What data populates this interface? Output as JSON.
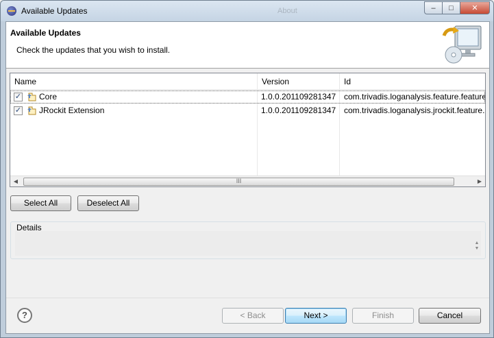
{
  "window": {
    "title": "Available Updates",
    "background_hint": "About",
    "minimize_label": "–",
    "maximize_label": "□",
    "close_label": "✕"
  },
  "banner": {
    "title": "Available Updates",
    "message": "Check the updates that you wish to install.",
    "icon": "update-monitor-icon"
  },
  "table": {
    "columns": [
      {
        "label": "Name"
      },
      {
        "label": "Version"
      },
      {
        "label": "Id"
      }
    ],
    "rows": [
      {
        "checked": true,
        "selected": true,
        "name": "Core",
        "version": "1.0.0.201109281347",
        "id": "com.trivadis.loganalysis.feature.feature"
      },
      {
        "checked": true,
        "selected": false,
        "name": "JRockit Extension",
        "version": "1.0.0.201109281347",
        "id": "com.trivadis.loganalysis.jrockit.feature."
      }
    ],
    "row_icon": "feature-plugin-icon",
    "scrollbar_thumb_grip": "III"
  },
  "selection_buttons": {
    "select_all": "Select All",
    "deselect_all": "Deselect All"
  },
  "details": {
    "label": "Details",
    "text": ""
  },
  "footer": {
    "help_label": "?",
    "back": "< Back",
    "next": "Next >",
    "finish": "Finish",
    "cancel": "Cancel",
    "back_enabled": false,
    "finish_enabled": false,
    "default_button": "next"
  }
}
